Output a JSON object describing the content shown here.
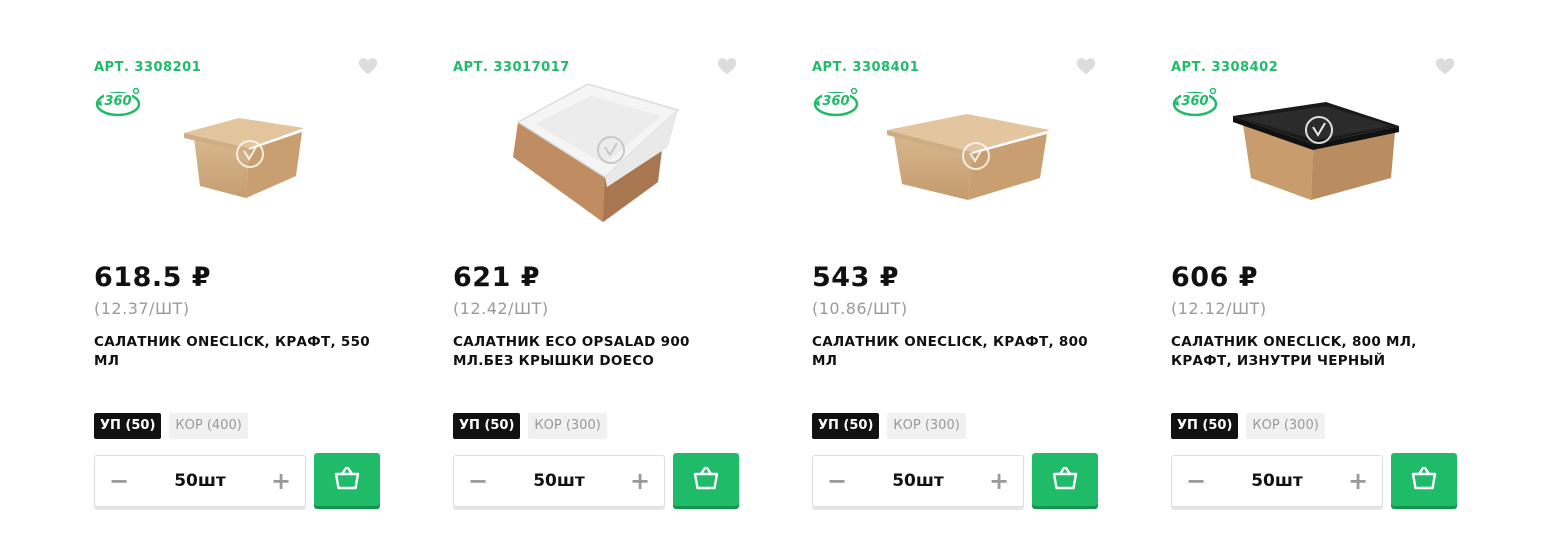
{
  "colors": {
    "accent": "#1fbb69",
    "muted": "#9a9a9a",
    "dark": "#111111"
  },
  "icons": {
    "favorite": "heart-icon",
    "view360": "rotate-360-icon",
    "cart": "basket-icon",
    "minus": "minus-icon",
    "plus": "plus-icon"
  },
  "products": [
    {
      "article": "АРТ. 3308201",
      "price": "618.5 ₽",
      "unit_price": "(12.37/ШТ)",
      "name": "Салатник OneClick, крафт, 550 мл",
      "has_360": true,
      "pack_options": [
        {
          "label": "УП (50)",
          "selected": true
        },
        {
          "label": "КОР (400)",
          "selected": false
        }
      ],
      "quantity": "50шт",
      "minus": "−",
      "plus": "+"
    },
    {
      "article": "АРТ. 33017017",
      "price": "621 ₽",
      "unit_price": "(12.42/ШТ)",
      "name": "Салатник ECO OpSalad 900 мл.без крышки DoEco",
      "has_360": false,
      "pack_options": [
        {
          "label": "УП (50)",
          "selected": true
        },
        {
          "label": "КОР (300)",
          "selected": false
        }
      ],
      "quantity": "50шт",
      "minus": "−",
      "plus": "+"
    },
    {
      "article": "АРТ. 3308401",
      "price": "543 ₽",
      "unit_price": "(10.86/ШТ)",
      "name": "Салатник OneClick, крафт, 800 мл",
      "has_360": true,
      "pack_options": [
        {
          "label": "УП (50)",
          "selected": true
        },
        {
          "label": "КОР (300)",
          "selected": false
        }
      ],
      "quantity": "50шт",
      "minus": "−",
      "plus": "+"
    },
    {
      "article": "АРТ. 3308402",
      "price": "606 ₽",
      "unit_price": "(12.12/ШТ)",
      "name": "Салатник OneClick, 800 мл, крафт, изнутри черный",
      "has_360": true,
      "pack_options": [
        {
          "label": "УП (50)",
          "selected": true
        },
        {
          "label": "КОР (300)",
          "selected": false
        }
      ],
      "quantity": "50шт",
      "minus": "−",
      "plus": "+"
    }
  ]
}
